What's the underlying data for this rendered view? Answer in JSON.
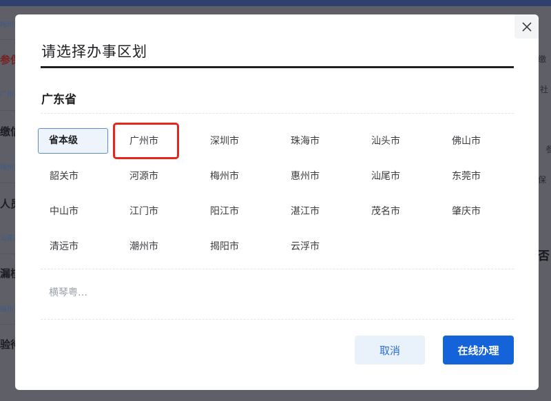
{
  "background": {
    "left_items": [
      {
        "text": "参保",
        "sub": "广州市"
      },
      {
        "text": "缴信",
        "sub": "梅州市"
      },
      {
        "text": "人员",
        "sub": "汕尾市"
      },
      {
        "text": "漏核",
        "sub": "梅州市"
      },
      {
        "text": "验待",
        "sub": ""
      }
    ],
    "left_top_sub": "梅州市",
    "right_items": [
      "缴",
      "社",
      "参",
      "保",
      "否"
    ]
  },
  "modal": {
    "title": "请选择办事区划",
    "province": "广东省",
    "cities": [
      "省本级",
      "广州市",
      "深圳市",
      "珠海市",
      "汕头市",
      "佛山市",
      "韶关市",
      "河源市",
      "梅州市",
      "惠州市",
      "汕尾市",
      "东莞市",
      "中山市",
      "江门市",
      "阳江市",
      "湛江市",
      "茂名市",
      "肇庆市",
      "清远市",
      "潮州市",
      "揭阳市",
      "云浮市"
    ],
    "selected_city": "省本级",
    "highlighted_city": "广州市",
    "more_label": "横琴粤…",
    "cancel_label": "取消",
    "confirm_label": "在线办理",
    "close_icon": "close-icon"
  },
  "colors": {
    "primary": "#1463d8",
    "highlight": "#e8241d"
  }
}
